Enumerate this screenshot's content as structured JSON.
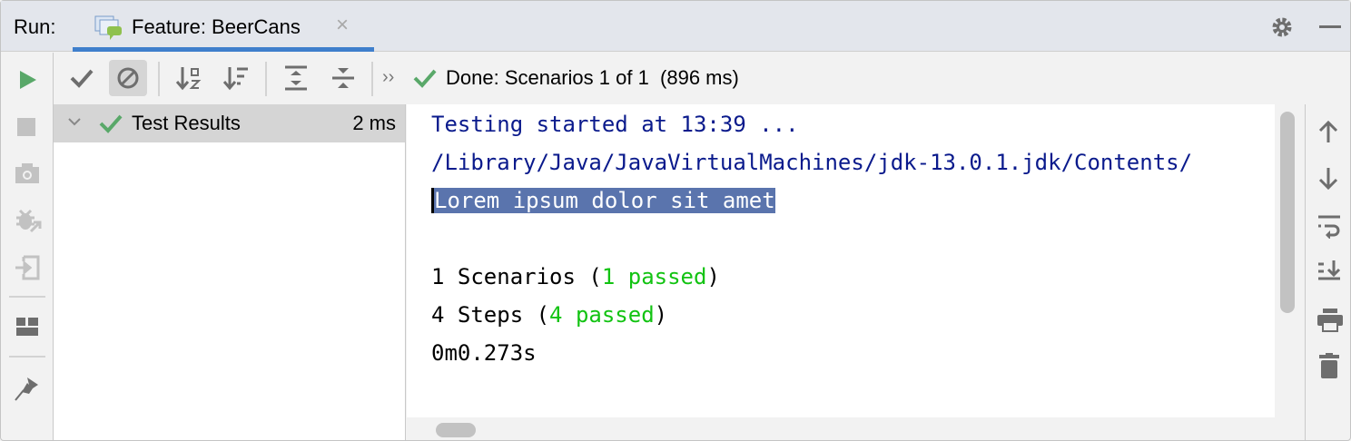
{
  "tabbar": {
    "run_label": "Run:",
    "tab_title": "Feature: BeerCans",
    "close": "×"
  },
  "toolbar": {
    "more": "››",
    "status": "Done: Scenarios 1 of 1  (896 ms)"
  },
  "tree": {
    "root_label": "Test Results",
    "root_duration": "2 ms"
  },
  "console": {
    "line1": "Testing started at 13:39 ...",
    "line2": "/Library/Java/JavaVirtualMachines/jdk-13.0.1.jdk/Contents/",
    "line3": "Lorem ipsum dolor sit amet",
    "scen_prefix": "1 Scenarios (",
    "scen_passed": "1 passed",
    "scen_suffix": ")",
    "steps_prefix": "4 Steps (",
    "steps_passed": "4 passed",
    "steps_suffix": ")",
    "time": "0m0.273s"
  },
  "colors": {
    "accent": "#3f7fcc",
    "passed": "#12c312",
    "run": "#59a869",
    "selection": "#5a74ad"
  }
}
